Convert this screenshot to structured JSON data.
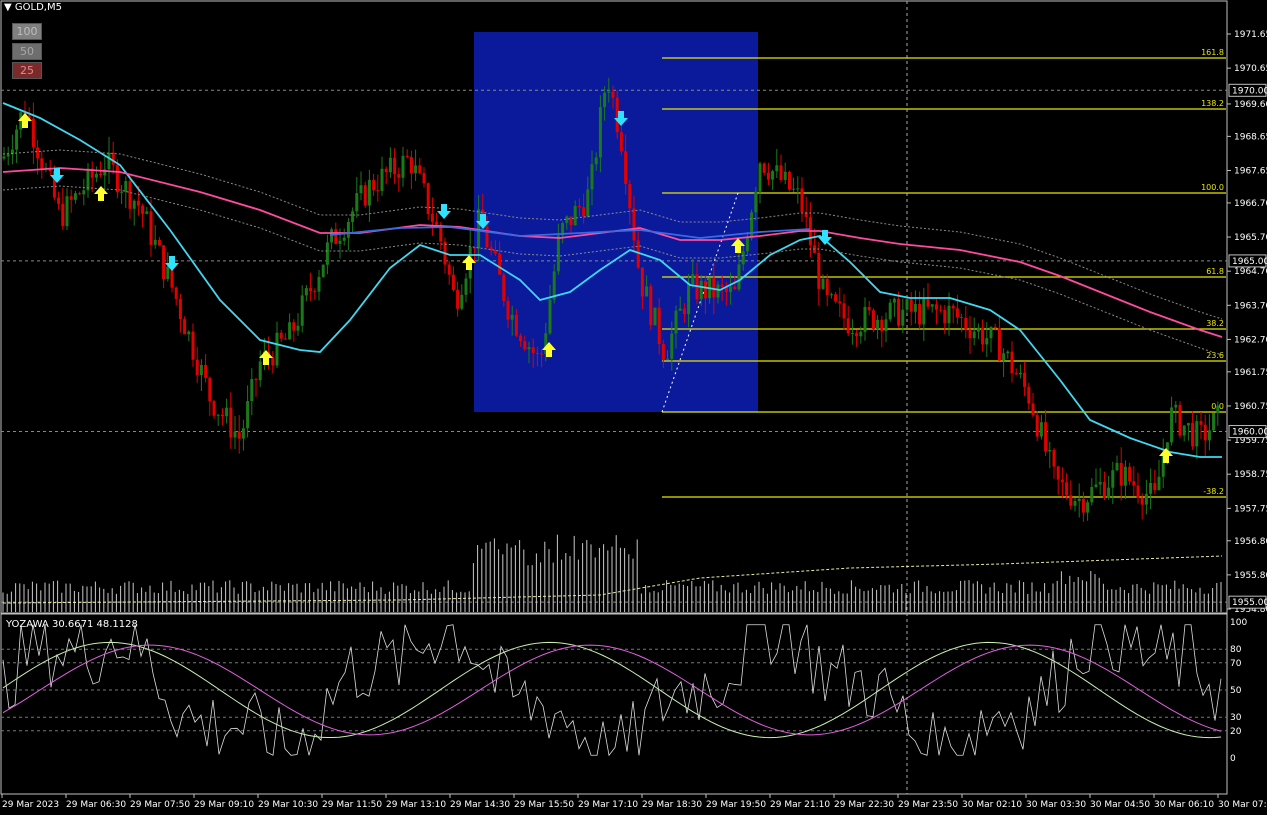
{
  "window": {
    "symbol": "GOLD,M5"
  },
  "buttons": [
    {
      "label": "100",
      "bg": "#808080",
      "fg": "#bdbdbd"
    },
    {
      "label": "50",
      "bg": "#6e6e6e",
      "fg": "#a8a8a8"
    },
    {
      "label": "25",
      "bg": "#7a2a2a",
      "fg": "#e58a8a"
    }
  ],
  "indicator": {
    "name": "YOZAWA",
    "v1": "30.6671",
    "v2": "48.1128"
  },
  "colors": {
    "bull": "#1a7a1a",
    "bear": "#e00000",
    "ma_fast": "#40d8f0",
    "ma_slow": "#ff4aa0",
    "ma_mid": "#3a6ae0",
    "fib": "#e6e600",
    "box": "#0a1a9a",
    "arrow_up": "#ffff30",
    "arrow_down": "#30e0ff",
    "volume": "#c8c8c8"
  },
  "price_axis": {
    "ticks": [
      "1971.65",
      "1970.65",
      "1969.60",
      "1968.65",
      "1967.65",
      "1966.70",
      "1965.70",
      "1964.70",
      "1963.70",
      "1962.70",
      "1961.75",
      "1960.75",
      "1959.75",
      "1958.75",
      "1957.75",
      "1956.80",
      "1955.80",
      "1954.80"
    ],
    "marked": [
      "1970.00",
      "1965.00",
      "1960.00",
      "1955.00"
    ]
  },
  "fib_levels": [
    "161.8",
    "138.2",
    "100.0",
    "61.8",
    "38.2",
    "23.6",
    "0.0",
    "-38.2"
  ],
  "osc_axis": [
    "100",
    "80",
    "70",
    "50",
    "30",
    "20",
    "0"
  ],
  "time_axis": [
    "29 Mar 2023",
    "29 Mar 06:30",
    "29 Mar 07:50",
    "29 Mar 09:10",
    "29 Mar 10:30",
    "29 Mar 11:50",
    "29 Mar 13:10",
    "29 Mar 14:30",
    "29 Mar 15:50",
    "29 Mar 17:10",
    "29 Mar 18:30",
    "29 Mar 19:50",
    "29 Mar 21:10",
    "29 Mar 22:30",
    "29 Mar 23:50",
    "30 Mar 02:10",
    "30 Mar 03:30",
    "30 Mar 04:50",
    "30 Mar 06:10",
    "30 Mar 07:3"
  ]
}
